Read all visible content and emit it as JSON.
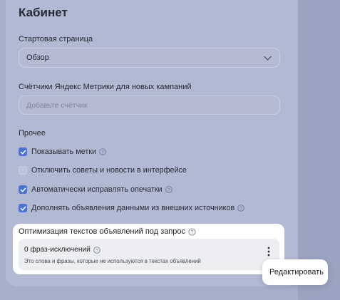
{
  "cabinet": {
    "title": "Кабинет",
    "start_page": {
      "label": "Стартовая страница",
      "value": "Обзор"
    },
    "counters": {
      "label": "Счётчики Яндекс Метрики для новых кампаний",
      "placeholder": "Добавьте счётчик"
    },
    "other": {
      "label": "Прочее",
      "checkboxes": [
        {
          "label": "Показывать метки",
          "checked": true
        },
        {
          "label": "Отключить советы и новости в интерфейсе",
          "checked": false
        },
        {
          "label": "Автоматически исправлять опечатки",
          "checked": true
        },
        {
          "label": "Дополнять объявления данными из внешних источников",
          "checked": true
        }
      ]
    },
    "optimization": {
      "title": "Оптимизация текстов объявлений под запрос",
      "phrases_title": "0 фраз-исключений",
      "phrases_desc": "Это слова и фразы, которые не используются в текстах объявлений",
      "menu_item": "Редактировать"
    }
  },
  "colors": {
    "accent": "#4a72d3",
    "overlay": "#a7afca",
    "card": "#b2b9d2"
  }
}
